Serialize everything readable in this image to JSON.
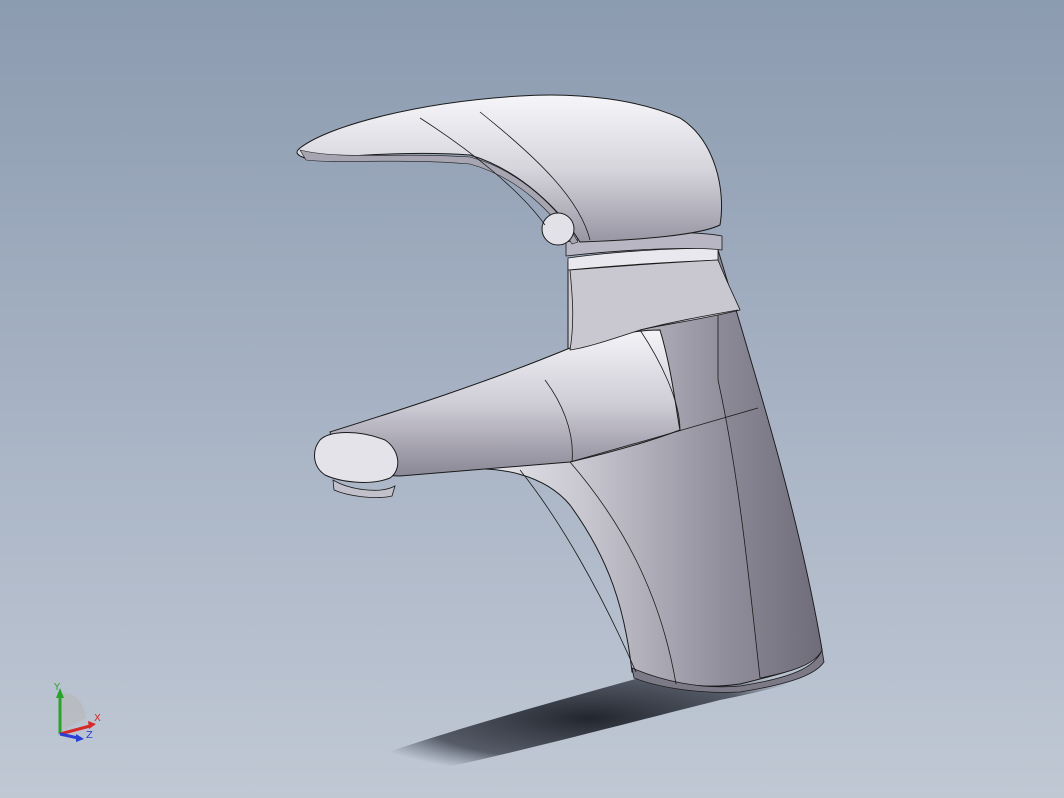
{
  "viewport": {
    "background_top": "#8c9bb0",
    "background_bottom": "#c0c8d4"
  },
  "model": {
    "part": "single-lever-faucet",
    "body_color": "#9a98a6",
    "highlight_color": "#f2f2f6",
    "edge_color": "#1a1a1a",
    "shadow_color": "#1a1e26"
  },
  "triad": {
    "x_label": "X",
    "y_label": "Y",
    "z_label": "Z",
    "x_color": "#d62a2a",
    "y_color": "#2aa32a",
    "z_color": "#2a3fd6"
  }
}
